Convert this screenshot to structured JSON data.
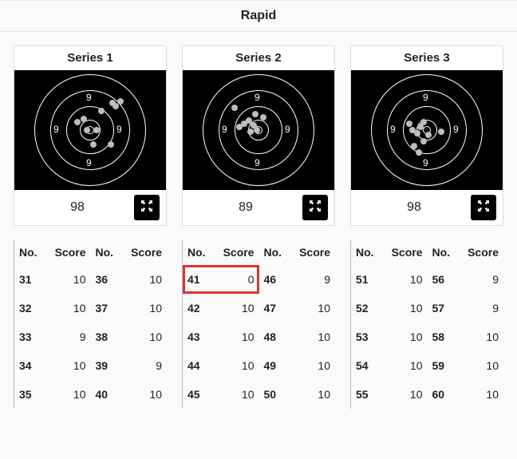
{
  "header": {
    "title": "Rapid"
  },
  "series": [
    {
      "title": "Series 1",
      "total": "98",
      "ring_labels": {
        "top": "9",
        "bottom": "9",
        "left": "9",
        "right": "9"
      },
      "hits": [
        {
          "x": 66,
          "y": 70
        },
        {
          "x": 78,
          "y": 70
        },
        {
          "x": 54,
          "y": 60
        },
        {
          "x": 62,
          "y": 56
        },
        {
          "x": 96,
          "y": 88
        },
        {
          "x": 102,
          "y": 40
        },
        {
          "x": 108,
          "y": 34
        },
        {
          "x": 98,
          "y": 36
        },
        {
          "x": 84,
          "y": 46
        },
        {
          "x": 74,
          "y": 88
        }
      ],
      "table": {
        "headers": {
          "no": "No.",
          "score": "Score"
        },
        "left": [
          {
            "no": "31",
            "score": "10"
          },
          {
            "no": "32",
            "score": "10"
          },
          {
            "no": "33",
            "score": "9"
          },
          {
            "no": "34",
            "score": "10"
          },
          {
            "no": "35",
            "score": "10"
          }
        ],
        "right": [
          {
            "no": "36",
            "score": "10"
          },
          {
            "no": "37",
            "score": "10"
          },
          {
            "no": "38",
            "score": "10"
          },
          {
            "no": "39",
            "score": "9"
          },
          {
            "no": "40",
            "score": "10"
          }
        ]
      }
    },
    {
      "title": "Series 2",
      "total": "89",
      "ring_labels": {
        "top": "9",
        "bottom": "9",
        "left": "9",
        "right": "9"
      },
      "hits": [
        {
          "x": 60,
          "y": 72
        },
        {
          "x": 68,
          "y": 70
        },
        {
          "x": 52,
          "y": 62
        },
        {
          "x": 58,
          "y": 58
        },
        {
          "x": 46,
          "y": 66
        },
        {
          "x": 64,
          "y": 64
        },
        {
          "x": 66,
          "y": 50
        },
        {
          "x": 76,
          "y": 54
        },
        {
          "x": 40,
          "y": 42
        }
      ],
      "table": {
        "headers": {
          "no": "No.",
          "score": "Score"
        },
        "left": [
          {
            "no": "41",
            "score": "0",
            "highlight": true
          },
          {
            "no": "42",
            "score": "10"
          },
          {
            "no": "43",
            "score": "10"
          },
          {
            "no": "44",
            "score": "10"
          },
          {
            "no": "45",
            "score": "10"
          }
        ],
        "right": [
          {
            "no": "46",
            "score": "9"
          },
          {
            "no": "47",
            "score": "10"
          },
          {
            "no": "48",
            "score": "10"
          },
          {
            "no": "49",
            "score": "10"
          },
          {
            "no": "50",
            "score": "10"
          }
        ]
      }
    },
    {
      "title": "Series 3",
      "total": "98",
      "ring_labels": {
        "top": "9",
        "bottom": "9",
        "left": "9",
        "right": "9"
      },
      "hits": [
        {
          "x": 58,
          "y": 74
        },
        {
          "x": 52,
          "y": 70
        },
        {
          "x": 48,
          "y": 62
        },
        {
          "x": 62,
          "y": 66
        },
        {
          "x": 66,
          "y": 60
        },
        {
          "x": 54,
          "y": 90
        },
        {
          "x": 60,
          "y": 98
        },
        {
          "x": 88,
          "y": 72
        },
        {
          "x": 72,
          "y": 76
        },
        {
          "x": 66,
          "y": 84
        }
      ],
      "table": {
        "headers": {
          "no": "No.",
          "score": "Score"
        },
        "left": [
          {
            "no": "51",
            "score": "10"
          },
          {
            "no": "52",
            "score": "10"
          },
          {
            "no": "53",
            "score": "10"
          },
          {
            "no": "54",
            "score": "10"
          },
          {
            "no": "55",
            "score": "10"
          }
        ],
        "right": [
          {
            "no": "56",
            "score": "9"
          },
          {
            "no": "57",
            "score": "9"
          },
          {
            "no": "58",
            "score": "10"
          },
          {
            "no": "59",
            "score": "10"
          },
          {
            "no": "60",
            "score": "10"
          }
        ]
      }
    }
  ]
}
